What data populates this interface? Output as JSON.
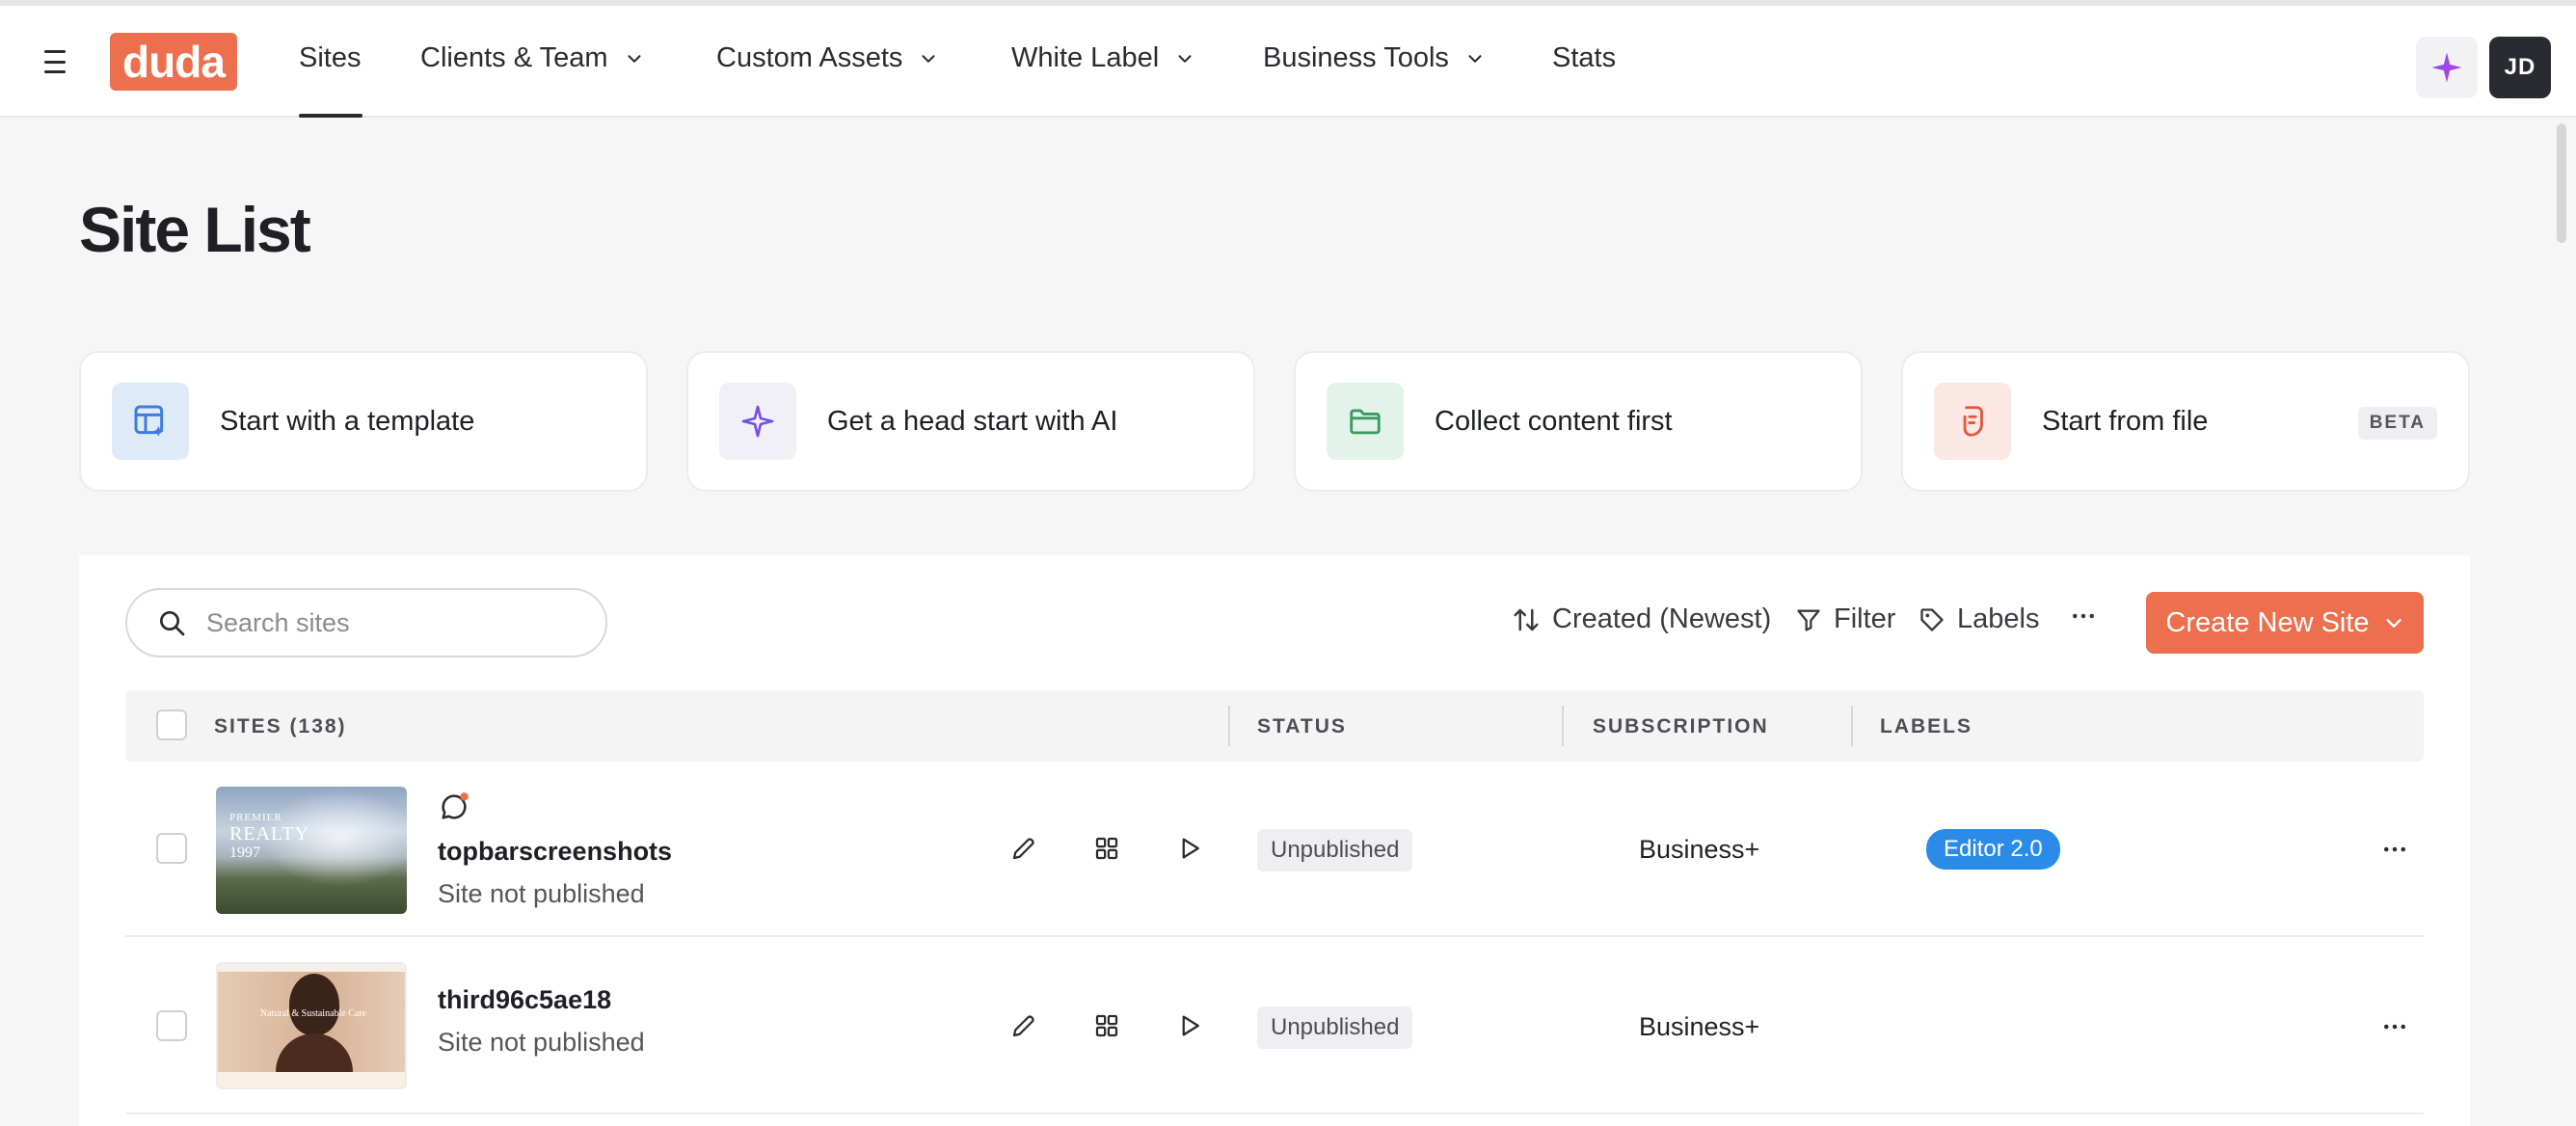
{
  "nav": {
    "logo": "duda",
    "items": [
      {
        "label": "Sites"
      },
      {
        "label": "Clients & Team"
      },
      {
        "label": "Custom Assets"
      },
      {
        "label": "White Label"
      },
      {
        "label": "Business Tools"
      },
      {
        "label": "Stats"
      }
    ],
    "avatar_initials": "JD"
  },
  "page": {
    "title": "Site List"
  },
  "quick_start": [
    {
      "label": "Start with a template"
    },
    {
      "label": "Get a head start with AI"
    },
    {
      "label": "Collect content first"
    },
    {
      "label": "Start from file",
      "badge": "BETA"
    }
  ],
  "toolbar": {
    "search_placeholder": "Search sites",
    "sort_label": "Created (Newest)",
    "filter_label": "Filter",
    "labels_label": "Labels",
    "create_label": "Create New Site"
  },
  "table": {
    "headers": {
      "sites": "SITES (138)",
      "status": "STATUS",
      "subscription": "SUBSCRIPTION",
      "labels": "LABELS"
    },
    "rows": [
      {
        "name": "topbarscreenshots",
        "sub": "Site not published",
        "status": "Unpublished",
        "subscription": "Business+",
        "label": "Editor 2.0",
        "thumb_text_1": "PREMIER",
        "thumb_text_2": "REALTY",
        "thumb_text_3": "1997"
      },
      {
        "name": "third96c5ae18",
        "sub": "Site not published",
        "status": "Unpublished",
        "subscription": "Business+",
        "label": "",
        "thumb_text_1": "Natural & Sustainable Care"
      }
    ]
  },
  "colors": {
    "brand": "#ec6f4e",
    "label_blue": "#2b8be8",
    "dark": "#2a2b30"
  }
}
